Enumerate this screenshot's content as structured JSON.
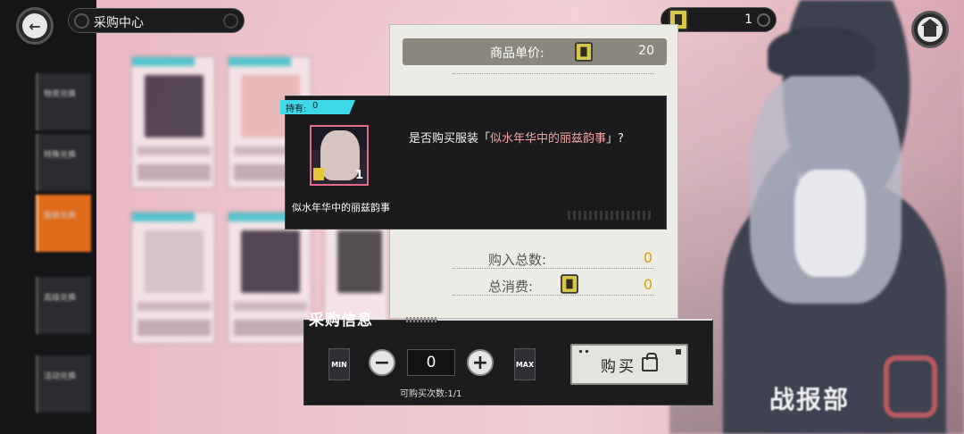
{
  "header": {
    "title": "采购中心",
    "currency_amount": "1"
  },
  "background": {
    "sidebar_items": [
      "物资兑换",
      "特殊兑换",
      "服装兑换",
      "高级兑换",
      "活动兑换"
    ],
    "emblem_text": "战报部"
  },
  "purchase": {
    "unit_price_label": "商品单价:",
    "unit_price": "20",
    "total_buy_label": "购入总数:",
    "total_buy_value": "0",
    "total_cost_label": "总消费:",
    "total_cost_value": "0"
  },
  "dialog": {
    "owned_label": "持有:",
    "owned_count": "0",
    "item_count": "1",
    "item_name": "似水年华中的丽兹韵事",
    "question_prefix": "是否购买服装「",
    "question_item": "似水年华中的丽兹韵事",
    "question_suffix": "」?"
  },
  "purchase_info": {
    "title": "采购信息",
    "min_label": "MIN",
    "max_label": "MAX",
    "quantity": "0",
    "minus_symbol": "−",
    "plus_symbol": "+",
    "times_label": "可购买次数:1/1",
    "buy_label": "购买"
  },
  "icons": {
    "back": "back-arrow-icon",
    "home": "home-icon",
    "currency": "token-icon",
    "settings": "gear-icon"
  },
  "colors": {
    "accent_cyan": "#3fd8e6",
    "highlight_pink": "#f3a6a6",
    "value_gold": "#d8a200",
    "active_orange": "#e06a1a"
  }
}
